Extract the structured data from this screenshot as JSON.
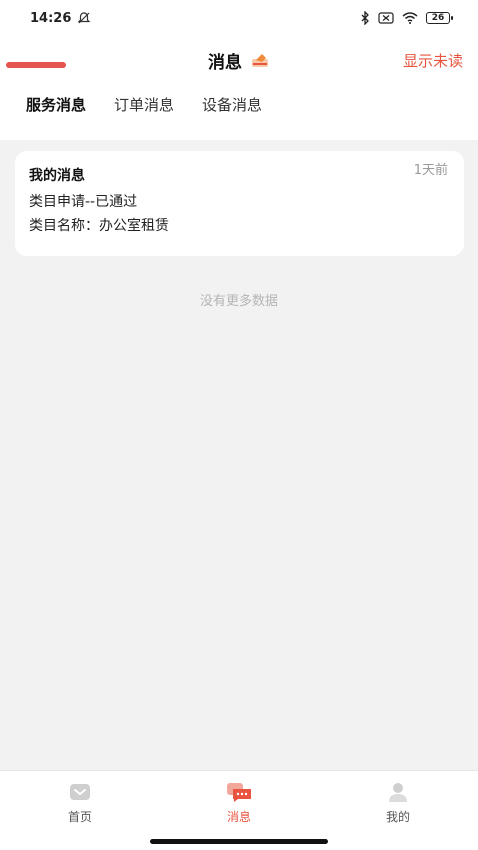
{
  "status_bar": {
    "time": "14:26",
    "battery": "26"
  },
  "header": {
    "title": "消息",
    "show_unread_label": "显示未读"
  },
  "tabs": [
    {
      "label": "服务消息",
      "active": true
    },
    {
      "label": "订单消息",
      "active": false
    },
    {
      "label": "设备消息",
      "active": false
    }
  ],
  "message_card": {
    "title": "我的消息",
    "time": "1天前",
    "line1": "类目申请--已通过",
    "line2": "类目名称：办公室租赁"
  },
  "no_more_text": "没有更多数据",
  "bottom_nav": [
    {
      "label": "首页",
      "icon": "home-icon",
      "active": false
    },
    {
      "label": "消息",
      "icon": "message-icon",
      "active": true
    },
    {
      "label": "我的",
      "icon": "profile-icon",
      "active": false
    }
  ],
  "colors": {
    "accent": "#e8543f",
    "background": "#f2f2f2",
    "card": "#ffffff"
  }
}
